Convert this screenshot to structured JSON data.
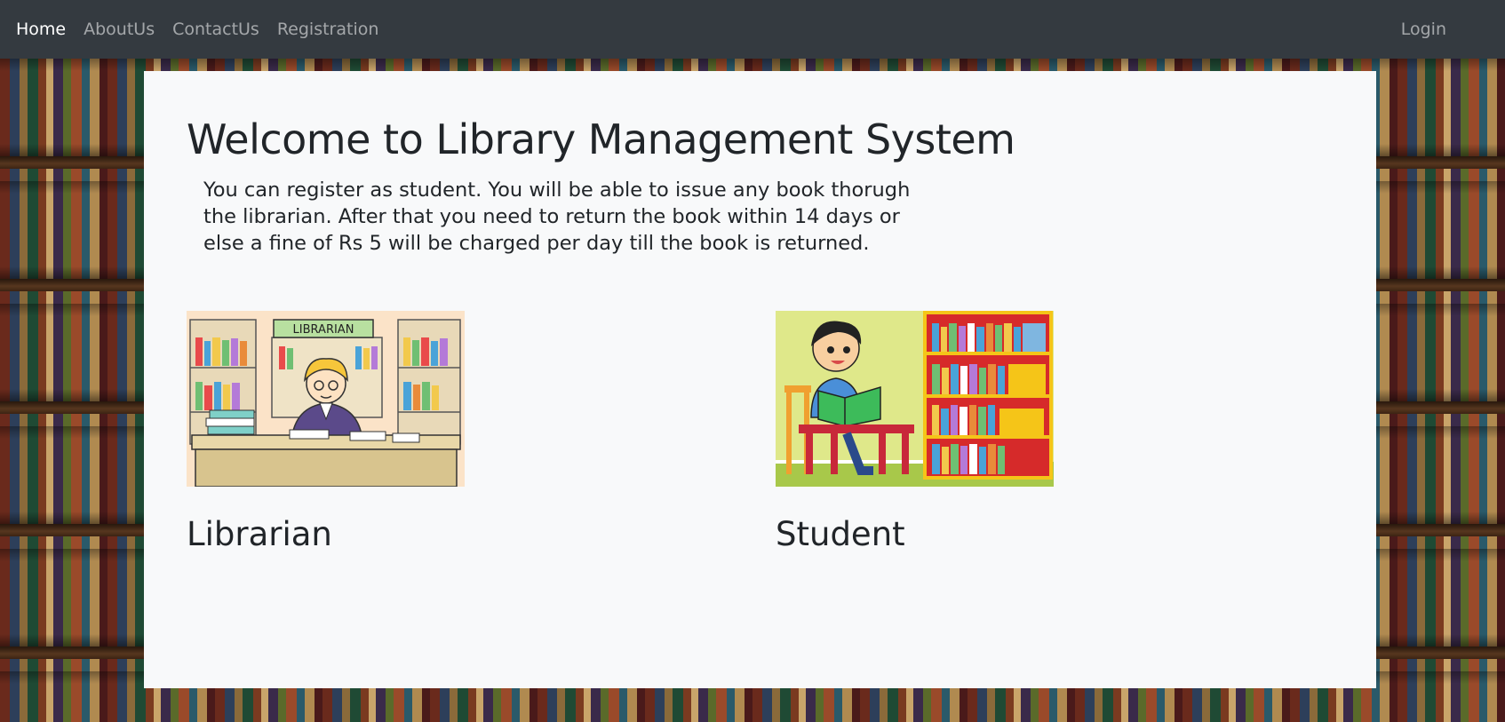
{
  "navbar": {
    "links": [
      {
        "label": "Home",
        "active": true
      },
      {
        "label": "AboutUs",
        "active": false
      },
      {
        "label": "ContactUs",
        "active": false
      },
      {
        "label": "Registration",
        "active": false
      }
    ],
    "login_label": "Login"
  },
  "main": {
    "title": "Welcome to Library Management System",
    "intro": "You can register as student. You will be able to issue any book thorugh the librarian. After that you need to return the book within 14 days or else a fine of Rs 5 will be charged per day till the book is returned.",
    "cards": [
      {
        "title": "Librarian",
        "image_sign": "LIBRARIAN",
        "image": "librarian-illustration"
      },
      {
        "title": "Student",
        "image": "student-reading-illustration"
      }
    ]
  },
  "colors": {
    "navbar_bg": "#343a40",
    "panel_bg": "#f8f9fa",
    "text": "#212529",
    "nav_active": "#ffffff",
    "nav_inactive": "rgba(255,255,255,0.55)"
  }
}
